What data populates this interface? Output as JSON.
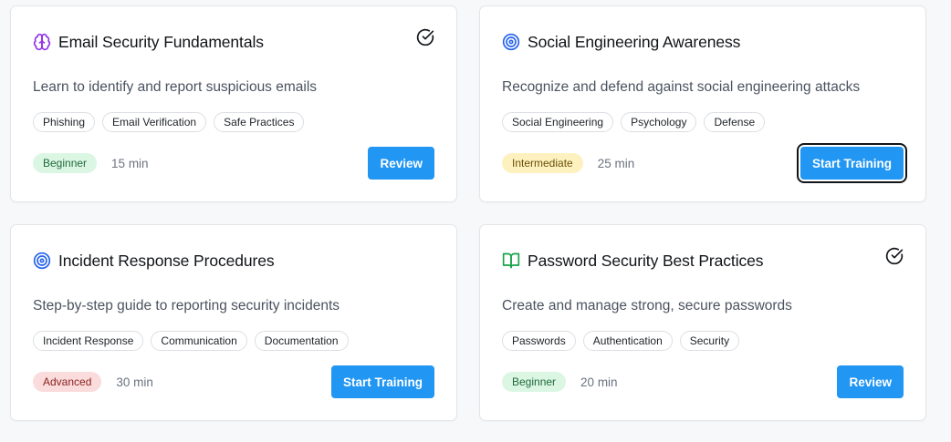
{
  "colors": {
    "accent": "#2196f3",
    "beginner_bg": "#dcf6e4",
    "intermediate_bg": "#fdf2bf",
    "advanced_bg": "#fbdcdc"
  },
  "cards": [
    {
      "icon": "brain-icon",
      "title": "Email Security Fundamentals",
      "completed": true,
      "description": "Learn to identify and report suspicious emails",
      "tags": [
        "Phishing",
        "Email Verification",
        "Safe Practices"
      ],
      "level": "Beginner",
      "duration": "15 min",
      "action": "Review"
    },
    {
      "icon": "target-icon",
      "title": "Social Engineering Awareness",
      "completed": false,
      "description": "Recognize and defend against social engineering attacks",
      "tags": [
        "Social Engineering",
        "Psychology",
        "Defense"
      ],
      "level": "Intermediate",
      "duration": "25 min",
      "action": "Start Training"
    },
    {
      "icon": "target-icon",
      "title": "Incident Response Procedures",
      "completed": false,
      "description": "Step-by-step guide to reporting security incidents",
      "tags": [
        "Incident Response",
        "Communication",
        "Documentation"
      ],
      "level": "Advanced",
      "duration": "30 min",
      "action": "Start Training"
    },
    {
      "icon": "book-open-icon",
      "title": "Password Security Best Practices",
      "completed": true,
      "description": "Create and manage strong, secure passwords",
      "tags": [
        "Passwords",
        "Authentication",
        "Security"
      ],
      "level": "Beginner",
      "duration": "20 min",
      "action": "Review"
    }
  ]
}
